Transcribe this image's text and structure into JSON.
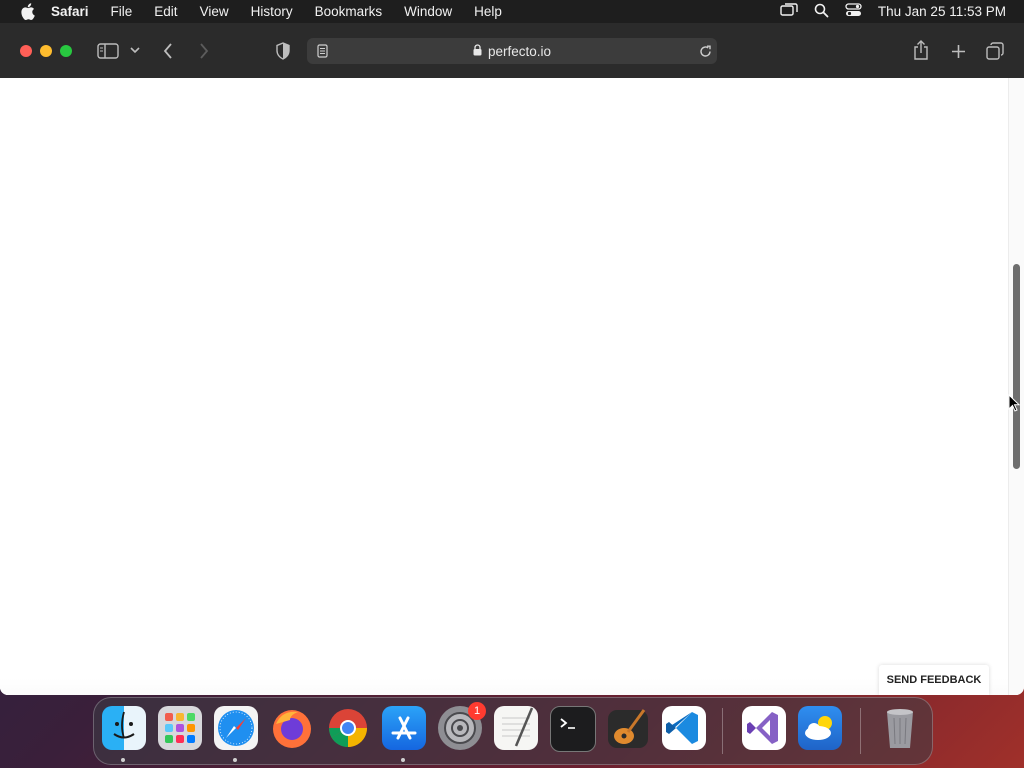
{
  "menubar": {
    "items": [
      "Safari",
      "File",
      "Edit",
      "View",
      "History",
      "Bookmarks",
      "Window",
      "Help"
    ],
    "clock": "Thu Jan 25  11:53 PM"
  },
  "browser": {
    "url": "perfecto.io"
  },
  "page": {
    "feedback_label": "SEND FEEDBACK",
    "scroll_position_fraction": 0.45
  },
  "dock": {
    "apps": [
      {
        "name": "Finder",
        "icon": "finder-icon",
        "running": true
      },
      {
        "name": "Launchpad",
        "icon": "launchpad-icon",
        "running": false
      },
      {
        "name": "Safari",
        "icon": "safari-icon",
        "running": true
      },
      {
        "name": "Firefox",
        "icon": "firefox-icon",
        "running": false
      },
      {
        "name": "Chrome",
        "icon": "chrome-icon",
        "running": false
      },
      {
        "name": "App Store",
        "icon": "app-store-icon",
        "running": true
      },
      {
        "name": "System Settings",
        "icon": "settings-icon",
        "running": false,
        "badge": "1"
      },
      {
        "name": "TextEdit",
        "icon": "textedit-icon",
        "running": false
      },
      {
        "name": "Terminal",
        "icon": "terminal-icon",
        "running": false
      },
      {
        "name": "GarageBand",
        "icon": "garageband-icon",
        "running": false
      },
      {
        "name": "VS Code",
        "icon": "vscode-icon",
        "running": false
      },
      {
        "name": "Visual Studio",
        "icon": "visual-studio-icon",
        "running": false
      },
      {
        "name": "Weather",
        "icon": "weather-icon",
        "running": false
      },
      {
        "name": "Trash",
        "icon": "trash-icon",
        "running": false
      }
    ]
  },
  "colors": {
    "close": "#ff5f57",
    "minimize": "#febc2e",
    "zoom": "#28c840",
    "badge": "#ff3b30"
  }
}
